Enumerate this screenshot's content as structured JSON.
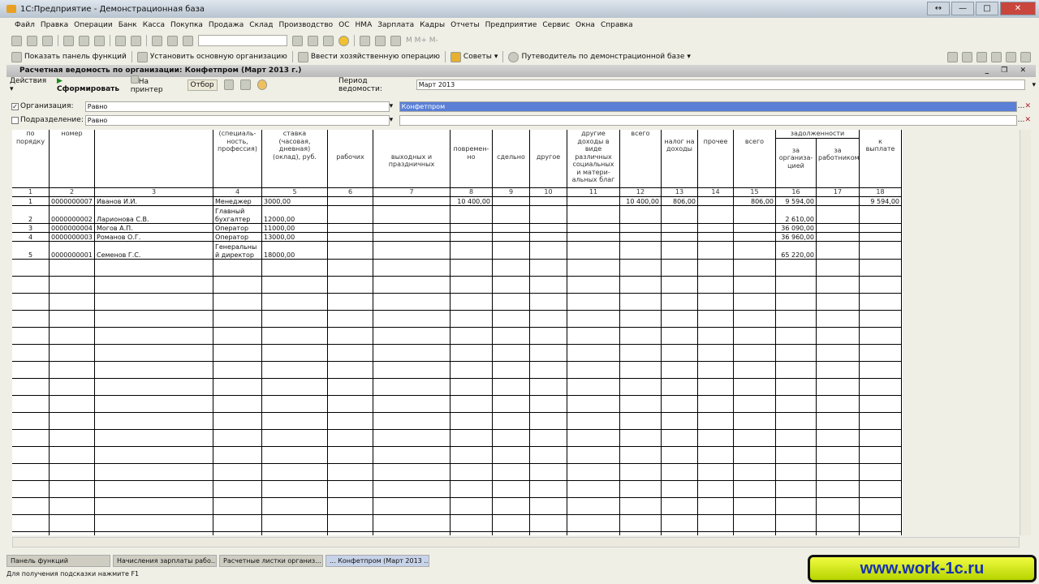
{
  "window": {
    "title": "1С:Предприятие - Демонстрационная база"
  },
  "menu": [
    "Файл",
    "Правка",
    "Операции",
    "Банк",
    "Касса",
    "Покупка",
    "Продажа",
    "Склад",
    "Производство",
    "ОС",
    "НМА",
    "Зарплата",
    "Кадры",
    "Отчеты",
    "Предприятие",
    "Сервис",
    "Окна",
    "Справка"
  ],
  "toolbar2": {
    "show_panel": "Показать панель функций",
    "set_org": "Установить основную организацию",
    "enter_op": "Ввести хозяйственную операцию",
    "tips": "Советы",
    "guide": "Путеводитель по демонстрационной базе"
  },
  "document": {
    "title": "Расчетная ведомость по организации: Конфетпром (Март 2013 г.)",
    "actions": "Действия",
    "generate": "Сформировать",
    "print": "На принтер",
    "filter": "Отбор",
    "period_label": "Период ведомости:",
    "period_value": "Март 2013"
  },
  "filters": [
    {
      "label": "Организация:",
      "checked": true,
      "condition": "Равно",
      "value": "Конфетпром"
    },
    {
      "label": "Подразделение:",
      "checked": false,
      "condition": "Равно",
      "value": ""
    }
  ],
  "table": {
    "headers": [
      "по\nпорядку",
      "номер",
      "",
      "(специаль-\nность,\nпрофессия)",
      "ставка\n(часовая,\nдневная)\n(оклад), руб.",
      "\n\n\nрабочих",
      "\n\n\nвыходных и\nпраздничных",
      "\n\nповремен-\nно",
      "\n\n\nсдельно",
      "\n\n\nдругое",
      "другие\nдоходы в\nвиде\nразличных\nсоциальных\nи матери-\nальных благ",
      "всего",
      "\nналог на\nдоходы",
      "\nпрочее",
      "\nвсего",
      "\nза\nорганиза-\nцией",
      "\nза\nработником",
      "\nк\nвыплате"
    ],
    "group_header": "задолженности",
    "numbers": [
      "1",
      "2",
      "3",
      "4",
      "5",
      "6",
      "7",
      "8",
      "9",
      "10",
      "11",
      "12",
      "13",
      "14",
      "15",
      "16",
      "17",
      "18"
    ],
    "rows": [
      [
        "1",
        "0000000007",
        "Иванов И.И.",
        "Менеджер",
        "3000,00",
        "",
        "",
        "10 400,00",
        "",
        "",
        "",
        "10 400,00",
        "806,00",
        "",
        "806,00",
        "9 594,00",
        "",
        "9 594,00"
      ],
      [
        "2",
        "0000000002",
        "Ларионова С.В.",
        "Главный бухгалтер",
        "12000,00",
        "",
        "",
        "",
        "",
        "",
        "",
        "",
        "",
        "",
        "",
        "2 610,00",
        "",
        ""
      ],
      [
        "3",
        "0000000004",
        "Могов А.П.",
        "Оператор",
        "11000,00",
        "",
        "",
        "",
        "",
        "",
        "",
        "",
        "",
        "",
        "",
        "36 090,00",
        "",
        ""
      ],
      [
        "4",
        "0000000003",
        "Романов О.Г.",
        "Оператор",
        "13000,00",
        "",
        "",
        "",
        "",
        "",
        "",
        "",
        "",
        "",
        "",
        "36 960,00",
        "",
        ""
      ],
      [
        "5",
        "0000000001",
        "Семенов Г.С.",
        "Генеральны й директор",
        "18000,00",
        "",
        "",
        "",
        "",
        "",
        "",
        "",
        "",
        "",
        "",
        "65 220,00",
        "",
        ""
      ]
    ]
  },
  "taskbar": [
    {
      "label": "Панель функций",
      "active": false
    },
    {
      "label": "Начисления зарплаты рабо...",
      "active": false
    },
    {
      "label": "Расчетные листки организ...",
      "active": false
    },
    {
      "label": "... Конфетпром (Март 2013 ...",
      "active": true
    }
  ],
  "status": "Для получения подсказки нажмите F1",
  "watermark": "www.work-1c.ru",
  "colors": {
    "selection": "#5b7fd6",
    "banner": "#d8f020"
  }
}
